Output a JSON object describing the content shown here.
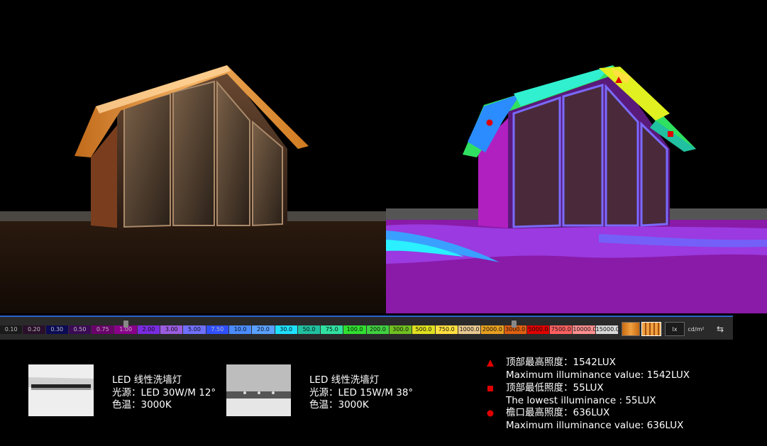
{
  "scale_bar": {
    "values": [
      "0.10",
      "0.20",
      "0.30",
      "0.50",
      "0.75",
      "1.00",
      "2.00",
      "3.00",
      "5.00",
      "7.50",
      "10.0",
      "20.0",
      "30.0",
      "50.0",
      "75.0",
      "100.0",
      "200.0",
      "300.0",
      "500.0",
      "750.0",
      "1000.0",
      "2000.0",
      "3000.0",
      "5000.0",
      "7500.0",
      "10000.0",
      "15000.0"
    ],
    "colors": [
      "#1a1a1a",
      "#2a0f2a",
      "#0b0b55",
      "#3b0b55",
      "#6a006a",
      "#8a008a",
      "#7a2be0",
      "#9b5ce0",
      "#7070ff",
      "#3050ff",
      "#4a8cff",
      "#5aa0ff",
      "#1ee0ff",
      "#20c0a0",
      "#30e0a0",
      "#30e030",
      "#40d040",
      "#70c020",
      "#e0e020",
      "#ffe040",
      "#e8c890",
      "#e8a020",
      "#e06010",
      "#e00000",
      "#ff6060",
      "#ff9090",
      "#d8d8d8"
    ],
    "unit_lx": "lx",
    "unit_cd": "cd/m²"
  },
  "fixtures": [
    {
      "name": "LED 线性洗墙灯",
      "source": "光源：LED 30W/M 12°",
      "cct": "色温：3000K"
    },
    {
      "name": "LED 线性洗墙灯",
      "source": "光源：LED 15W/M 38°",
      "cct": "色温：3000K"
    }
  ],
  "legend": [
    {
      "symbol": "triangle",
      "color": "#e00000",
      "zh": "顶部最高照度：1542LUX",
      "en": "Maximum illuminance value: 1542LUX"
    },
    {
      "symbol": "square",
      "color": "#e00000",
      "zh": "顶部最低照度：55LUX",
      "en": "The lowest illuminance : 55LUX"
    },
    {
      "symbol": "circle",
      "color": "#e00000",
      "zh": "檐口最高照度：636LUX",
      "en": "Maximum illuminance value: 636LUX"
    }
  ]
}
